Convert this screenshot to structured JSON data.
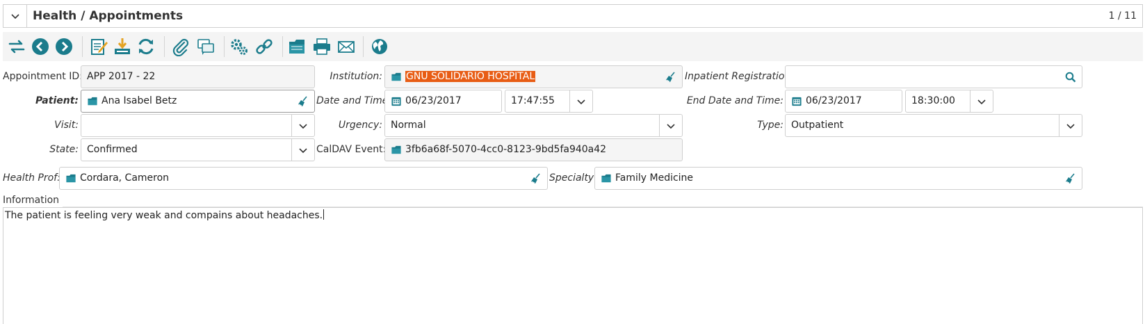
{
  "header": {
    "title": "Health / Appointments",
    "record_counter": "1 / 11"
  },
  "toolbar": {
    "buttons": [
      {
        "icon": "switch-view-icon"
      },
      {
        "icon": "previous-record-icon"
      },
      {
        "icon": "next-record-icon"
      },
      {
        "icon": "new-record-icon"
      },
      {
        "icon": "save-icon"
      },
      {
        "icon": "reload-icon"
      },
      {
        "icon": "attachment-icon"
      },
      {
        "icon": "notes-icon"
      },
      {
        "icon": "actions-icon"
      },
      {
        "icon": "relate-icon"
      },
      {
        "icon": "open-folder-icon"
      },
      {
        "icon": "print-icon"
      },
      {
        "icon": "email-icon"
      },
      {
        "icon": "globe-icon"
      }
    ],
    "accent": "#1b7c8c"
  },
  "form": {
    "appointment_id": {
      "label": "Appointment ID:",
      "value": "APP 2017 - 22"
    },
    "institution": {
      "label": "Institution:",
      "value": "GNU SOLIDARIO HOSPITAL"
    },
    "inpatient_registration": {
      "label": "Inpatient Registration:",
      "value": ""
    },
    "patient": {
      "label": "Patient:",
      "value": "Ana Isabel Betz"
    },
    "date_time": {
      "label": "Date and Time:",
      "date": "06/23/2017",
      "time": "17:47:55"
    },
    "end_date_time": {
      "label": "End Date and Time:",
      "date": "06/23/2017",
      "time": "18:30:00"
    },
    "visit": {
      "label": "Visit:",
      "value": ""
    },
    "urgency": {
      "label": "Urgency:",
      "value": "Normal"
    },
    "type": {
      "label": "Type:",
      "value": "Outpatient"
    },
    "state": {
      "label": "State:",
      "value": "Confirmed"
    },
    "caldav_event": {
      "label": "CalDAV Event:",
      "value": "3fb6a68f-5070-4cc0-8123-9bd5fa940a42"
    },
    "health_prof": {
      "label": "Health Prof:",
      "value": "Cordara, Cameron"
    },
    "specialty": {
      "label": "Specialty:",
      "value": "Family Medicine"
    },
    "information": {
      "label": "Information",
      "value": "The patient is feeling very weak and compains about headaches."
    }
  },
  "colors": {
    "selection": "#e85d15",
    "icon_teal": "#1b7c8c"
  }
}
